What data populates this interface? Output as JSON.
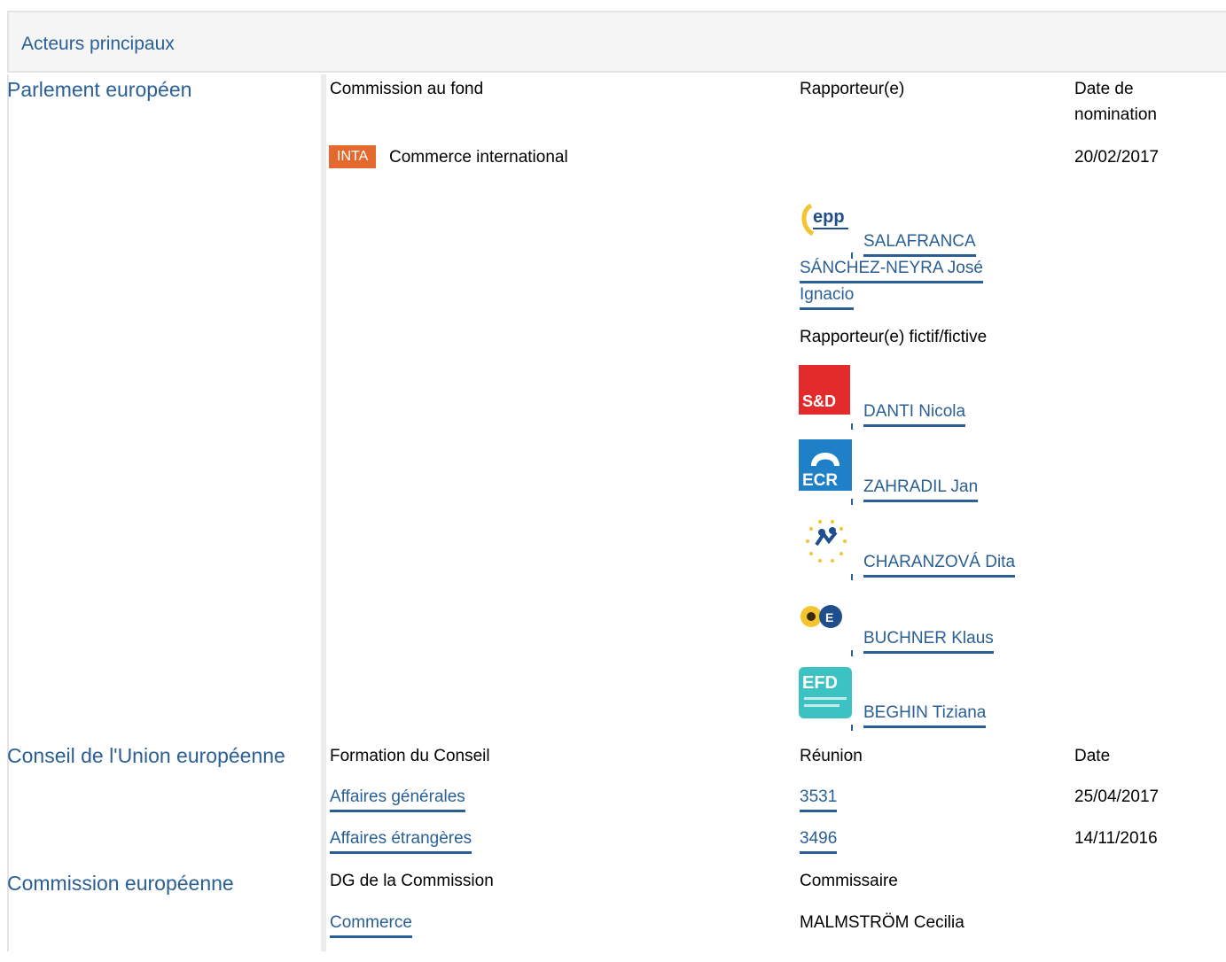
{
  "header": {
    "title": "Acteurs principaux"
  },
  "parliament": {
    "label": "Parlement européen",
    "col_committee": "Commission au fond",
    "col_rapporteur": "Rapporteur(e)",
    "col_date": "Date de nomination",
    "committee_badge": "INTA",
    "committee_name": "Commerce international",
    "committee_date": "20/02/2017",
    "rapporteur": {
      "logo": "EPP",
      "name_lines": [
        "SALAFRANCA",
        "SÁNCHEZ-NEYRA José",
        "Ignacio"
      ]
    },
    "shadow_label": "Rapporteur(e) fictif/fictive",
    "shadows": [
      {
        "logo": "S&D",
        "name": "DANTI Nicola"
      },
      {
        "logo": "ECR",
        "name": "ZAHRADIL Jan"
      },
      {
        "logo": "ALDE",
        "name": "CHARANZOVÁ Dita"
      },
      {
        "logo": "Verts/ALE",
        "name": "BUCHNER Klaus"
      },
      {
        "logo": "EFD",
        "name": "BEGHIN Tiziana"
      }
    ],
    "colors": {
      "accent": "#2a5f95",
      "badge": "#e3692f"
    }
  },
  "council": {
    "label": "Conseil de l'Union européenne",
    "col_formation": "Formation du Conseil",
    "col_meeting": "Réunion",
    "col_date": "Date",
    "rows": [
      {
        "formation": "Affaires générales",
        "meeting": "3531",
        "date": "25/04/2017"
      },
      {
        "formation": "Affaires étrangères",
        "meeting": "3496",
        "date": "14/11/2016"
      }
    ]
  },
  "commission": {
    "label": "Commission européenne",
    "col_dg": "DG de la Commission",
    "col_commissioner": "Commissaire",
    "dg": "Commerce",
    "commissioner": "MALMSTRÖM Cecilia"
  }
}
